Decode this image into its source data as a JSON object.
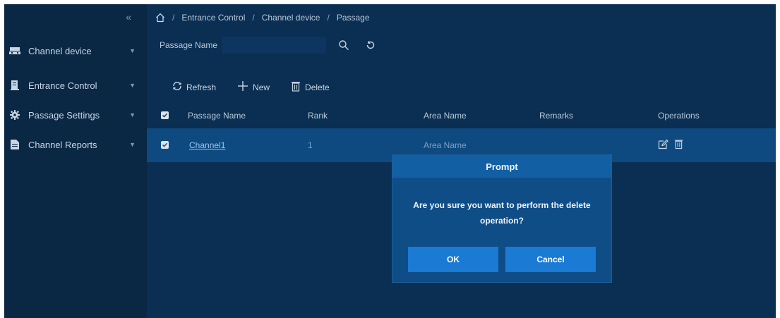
{
  "sidebar": {
    "collapse_glyph": "«",
    "items": [
      {
        "label": "Channel device",
        "icon": "device-icon"
      },
      {
        "label": "Entrance Control",
        "icon": "gate-icon"
      },
      {
        "label": "Passage Settings",
        "icon": "gear-icon"
      },
      {
        "label": "Channel Reports",
        "icon": "report-icon"
      }
    ]
  },
  "breadcrumb": {
    "items": [
      "Entrance Control",
      "Channel device",
      "Passage"
    ],
    "separator": "/"
  },
  "search": {
    "label": "Passage Name",
    "value": "",
    "placeholder": ""
  },
  "toolbar": {
    "refresh_label": "Refresh",
    "new_label": "New",
    "delete_label": "Delete"
  },
  "table": {
    "columns": [
      "Passage Name",
      "Rank",
      "Area Name",
      "Remarks",
      "Operations"
    ],
    "rows": [
      {
        "passage_name": "Channel1",
        "rank": "1",
        "area_name": "Area Name",
        "remarks": ""
      }
    ]
  },
  "dialog": {
    "title": "Prompt",
    "message": "Are you sure you want to perform the delete operation?",
    "ok_label": "OK",
    "cancel_label": "Cancel"
  },
  "colors": {
    "sidebar_bg": "#0a2744",
    "main_bg": "#0b2f52",
    "selected_row": "#0e4a80",
    "dialog_bg": "#0f4d87",
    "button": "#1a7ad4"
  }
}
